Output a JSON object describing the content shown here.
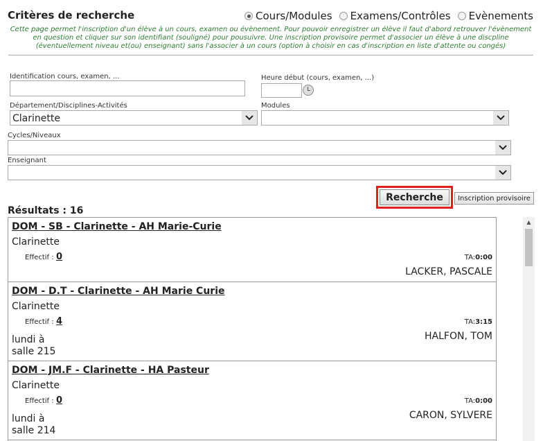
{
  "header": {
    "title": "Critères de recherche",
    "radios": [
      {
        "label": "Cours/Modules",
        "checked": true
      },
      {
        "label": "Examens/Contrôles",
        "checked": false
      },
      {
        "label": "Evènements",
        "checked": false
      }
    ],
    "description": "Cette page permet l'inscription d'un élève à un cours, examen ou évènement. Pour pouvoir enregistrer un élève il faut d'abord retrouver l'évènement en question et cliquer sur son identifiant (souligné) pour pousuivre. Une inscription provisoire permet d'associer un élève à une discpline (éventuellement niveau et(ou) enseignant) sans l'associer à un cours (option à choisir en cas d'inscription en liste d'attente ou congés)"
  },
  "form": {
    "identification_label": "Identification cours, examen, ...",
    "identification_value": "",
    "heure_label": "Heure début (cours, examen, ...)",
    "heure_value": "",
    "departement_label": "Département/Disciplines-Activités",
    "departement_value": "Clarinette",
    "modules_label": "Modules",
    "modules_value": "",
    "cycles_label": "Cycles/Niveaux",
    "cycles_value": "",
    "enseignant_label": "Enseignant",
    "enseignant_value": ""
  },
  "buttons": {
    "recherche": "Recherche",
    "inscription_provisoire": "Inscription provisoire"
  },
  "results": {
    "title": "Résultats : 16",
    "effectif_label": "Effectif :",
    "ta_label": "TA:",
    "items": [
      {
        "title": "DOM - SB - Clarinette - AH Marie-Curie",
        "discipline": "Clarinette",
        "effectif": "0",
        "ta": "0:00",
        "teacher": "LACKER, PASCALE",
        "jour": "",
        "salle": ""
      },
      {
        "title": "DOM - D.T - Clarinette - AH Marie Curie",
        "discipline": "Clarinette",
        "effectif": "4",
        "ta": "3:15",
        "teacher": "HALFON, TOM",
        "jour": "lundi à",
        "salle": "salle 215"
      },
      {
        "title": "DOM - JM.F - Clarinette - HA Pasteur",
        "discipline": "Clarinette",
        "effectif": "0",
        "ta": "0:00",
        "teacher": "CARON, SYLVERE",
        "jour": "lundi à",
        "salle": "salle 214"
      }
    ]
  }
}
